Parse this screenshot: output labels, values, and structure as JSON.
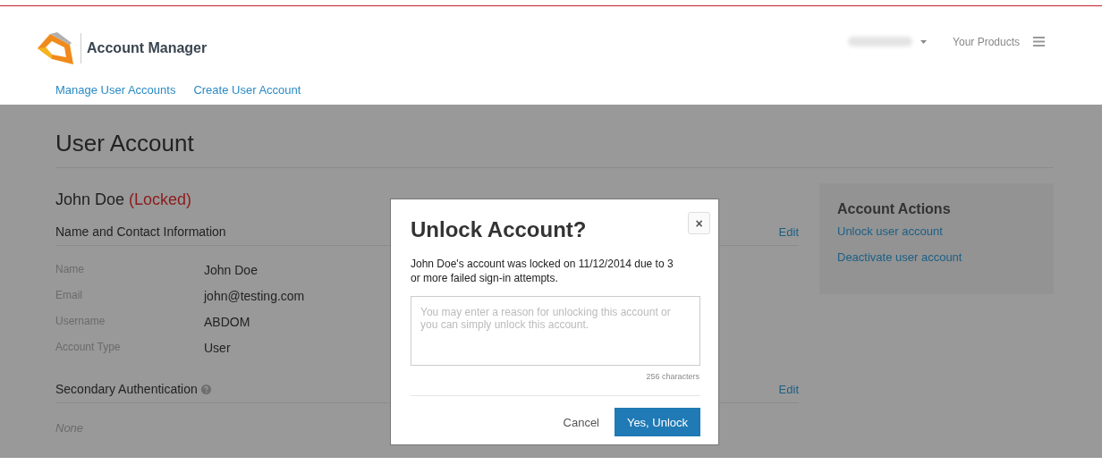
{
  "header": {
    "app_title": "Account Manager",
    "products_label": "Your Products"
  },
  "nav": [
    {
      "label": "Manage User Accounts"
    },
    {
      "label": "Create User Account"
    }
  ],
  "page_title": "User Account",
  "user": {
    "name": "John Doe",
    "status": "(Locked)",
    "locked": true
  },
  "sections": [
    {
      "title": "Name and Contact Information",
      "edit": "Edit",
      "kind": "fields",
      "fields": [
        {
          "label": "Name",
          "value": "John Doe"
        },
        {
          "label": "Email",
          "value": "john@testing.com"
        },
        {
          "label": "Username",
          "value": "ABDOM"
        },
        {
          "label": "Account Type",
          "value": "User"
        }
      ]
    },
    {
      "title": "Secondary Authentication",
      "edit": "Edit",
      "kind": "empty",
      "empty_text": "None"
    }
  ],
  "actions": {
    "title": "Account Actions",
    "links": [
      "Unlock user account",
      "Deactivate user account"
    ]
  },
  "modal": {
    "title": "Unlock Account?",
    "close": "×",
    "message": "John Doe's account was locked on 11/12/2014 due to 3 or more failed sign-in attempts.",
    "placeholder": "You may enter a reason for unlocking this account or you can simply unlock this account.",
    "counter": "256 characters",
    "cancel": "Cancel",
    "confirm": "Yes, Unlock"
  }
}
